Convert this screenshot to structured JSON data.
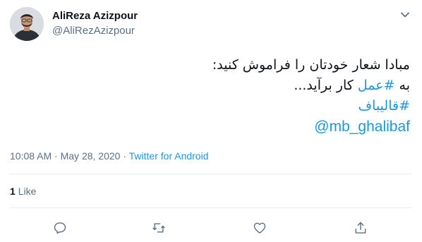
{
  "author": {
    "name": "AliReza Azizpour",
    "handle": "@AliRezAzizpour"
  },
  "tweet": {
    "line1": "مبادا شعار خودتان را فراموش کنید:",
    "line2_prefix": "به ",
    "line2_hashtag": "#عمل",
    "line2_suffix": " کار برآید...",
    "hashtag2": "#قالیباف",
    "mention": "@mb_ghalibaf"
  },
  "meta": {
    "time": "10:08 AM",
    "separator1": " · ",
    "date": "May 28, 2020",
    "separator2": " · ",
    "source": "Twitter for Android"
  },
  "stats": {
    "like_count": "1",
    "like_label": "Like"
  },
  "icons": {
    "more": "chevron-down-icon",
    "reply": "reply-icon",
    "retweet": "retweet-icon",
    "like": "heart-icon",
    "share": "share-icon"
  },
  "colors": {
    "link": "#1b95e0",
    "secondary_text": "#5b7083",
    "divider": "#e6ecf0"
  }
}
